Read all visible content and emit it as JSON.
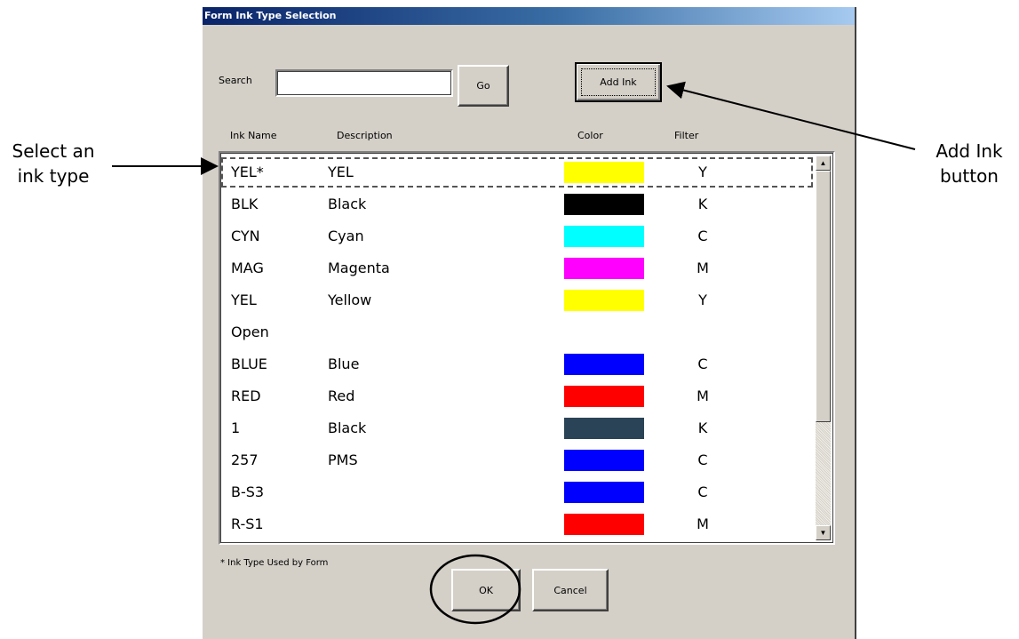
{
  "window": {
    "title": "Form Ink Type Selection"
  },
  "search": {
    "label": "Search",
    "value": "",
    "go_label": "Go"
  },
  "add_ink": {
    "label": "Add Ink"
  },
  "columns": {
    "name": "Ink Name",
    "description": "Description",
    "color": "Color",
    "filter": "Filter"
  },
  "inks": [
    {
      "name": "YEL*",
      "description": "YEL",
      "color": "#ffff00",
      "filter": "Y",
      "selected": true
    },
    {
      "name": "BLK",
      "description": "Black",
      "color": "#000000",
      "filter": "K"
    },
    {
      "name": "CYN",
      "description": "Cyan",
      "color": "#00ffff",
      "filter": "C"
    },
    {
      "name": "MAG",
      "description": "Magenta",
      "color": "#ff00ff",
      "filter": "M"
    },
    {
      "name": "YEL",
      "description": "Yellow",
      "color": "#ffff00",
      "filter": "Y"
    },
    {
      "name": "Open",
      "description": "",
      "color": "",
      "filter": ""
    },
    {
      "name": "BLUE",
      "description": "Blue",
      "color": "#0000ff",
      "filter": "C"
    },
    {
      "name": "RED",
      "description": "Red",
      "color": "#ff0000",
      "filter": "M"
    },
    {
      "name": "1",
      "description": "Black",
      "color": "#2a4356",
      "filter": "K"
    },
    {
      "name": "257",
      "description": "PMS",
      "color": "#0000ff",
      "filter": "C"
    },
    {
      "name": "B-S3",
      "description": "",
      "color": "#0000ff",
      "filter": "C"
    },
    {
      "name": "R-S1",
      "description": "",
      "color": "#ff0000",
      "filter": "M"
    },
    {
      "name": "",
      "description": "",
      "color": "#33dd33",
      "filter": ""
    }
  ],
  "footnote": "* Ink Type  Used by Form",
  "buttons": {
    "ok": "OK",
    "cancel": "Cancel"
  },
  "annotations": {
    "select_ink": "Select an\nink type",
    "add_ink_button": "Add Ink\nbutton"
  },
  "icons": {
    "scroll_up": "scroll-up-arrow-icon",
    "scroll_down": "scroll-down-arrow-icon"
  }
}
